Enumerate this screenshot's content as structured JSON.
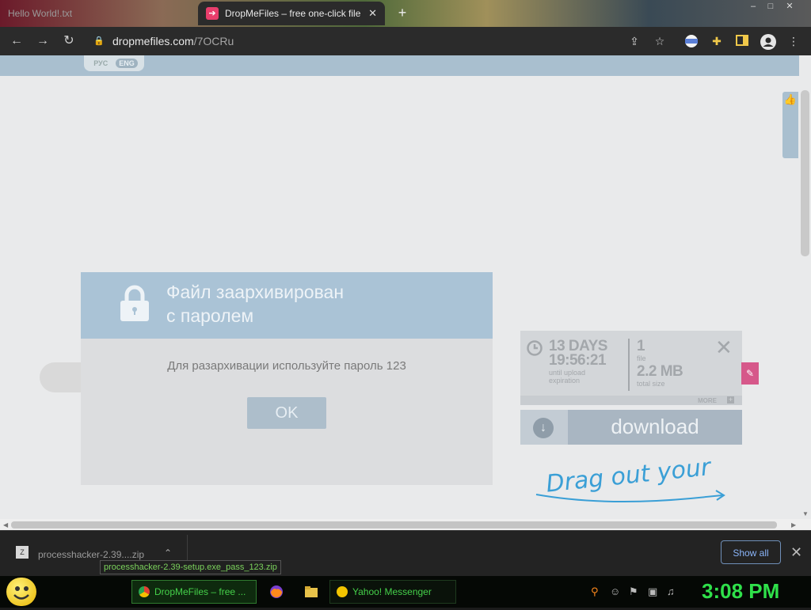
{
  "browser": {
    "tabs": [
      {
        "title": "Hello World!.txt",
        "active": false
      },
      {
        "title": "DropMeFiles – free one-click file",
        "active": true
      }
    ],
    "new_tab": "+",
    "url_host": "dropmefiles.com",
    "url_path": "/7OCRu",
    "window_controls": [
      "–",
      "□",
      "✕"
    ]
  },
  "page": {
    "lang_options": [
      "РУС",
      "ENG"
    ],
    "lang_active": "ENG",
    "modal": {
      "title_line1": "Файл заархивирован",
      "title_line2": "с паролем",
      "message": "Для разархивации используйте пароль 123",
      "ok_label": "OK"
    },
    "info": {
      "days": "13 DAYS",
      "time": "19:56:21",
      "expiry_label_1": "until upload",
      "expiry_label_2": "expiration",
      "file_count": "1",
      "file_label": "file",
      "size": "2.2 MB",
      "size_label": "total size",
      "more": "MORE"
    },
    "download_label": "download",
    "drag_text": "Drag out your"
  },
  "download_shelf": {
    "file_name": "processhacker-2.39....zip",
    "tooltip": "processhacker-2.39-setup.exe_pass_123.zip",
    "show_all": "Show all"
  },
  "taskbar": {
    "items": [
      {
        "label": "DropMeFiles – free ..."
      },
      {
        "label": "Yahoo! Messenger"
      }
    ],
    "clock": "3:08 PM"
  },
  "colors": {
    "accent_blue": "#aac3d6",
    "tab_favicon": "#e83e6c",
    "taskbar_green": "#2fe04a",
    "link_blue": "#8ab4f8"
  }
}
